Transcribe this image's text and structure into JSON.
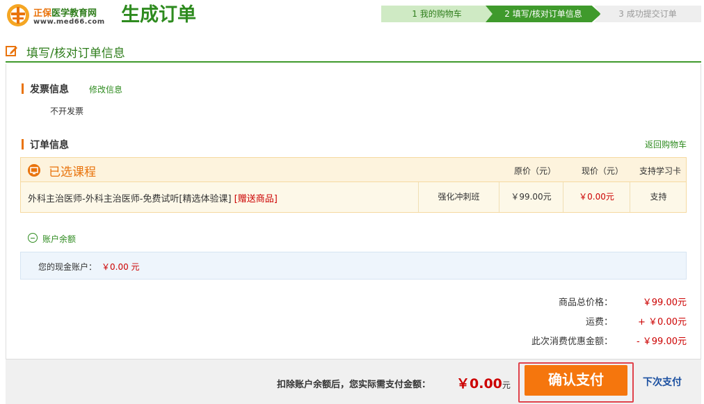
{
  "header": {
    "brand_cn": "正保",
    "brand_cn2": "医学教育网",
    "brand_url": "www.med66.com",
    "page_title": "生成订单"
  },
  "steps": [
    {
      "label": "1  我的购物车"
    },
    {
      "label": "2  填写/核对订单信息"
    },
    {
      "label": "3  成功提交订单"
    }
  ],
  "section": {
    "title": "填写/核对订单信息"
  },
  "invoice": {
    "title": "发票信息",
    "modify_link": "修改信息",
    "value": "不开发票"
  },
  "order": {
    "title": "订单信息",
    "back_link": "返回购物车",
    "course_caption": "已选课程",
    "columns": {
      "orig_price": "原价（元）",
      "cur_price": "现价（元）",
      "study_card": "支持学习卡"
    },
    "items": [
      {
        "name": "外科主治医师-外科主治医师-免费试听[精选体验课]",
        "gift": "[赠送商品]",
        "type": "强化冲刺班",
        "orig_price": "￥99.00元",
        "cur_price": "￥0.00元",
        "study_card": "支持"
      }
    ]
  },
  "balance": {
    "toggle_label": "账户余额",
    "cash_label": "您的现金账户：",
    "cash_value": "￥0.00 元"
  },
  "totals": [
    {
      "label": "商品总价格：",
      "value": "￥99.00元"
    },
    {
      "label": "运费：",
      "value": "+ ￥0.00元"
    },
    {
      "label": "此次消费优惠金额：",
      "value": "- ￥99.00元"
    }
  ],
  "footer": {
    "desc": "扣除账户余额后，您实际需支付金额：",
    "amount": "￥0.00",
    "unit": "元",
    "pay_button": "确认支付",
    "next_pay": "下次支付"
  },
  "colors": {
    "brand_green": "#2e8b1f",
    "accent_orange": "#f5760d",
    "price_red": "#cc0000"
  }
}
